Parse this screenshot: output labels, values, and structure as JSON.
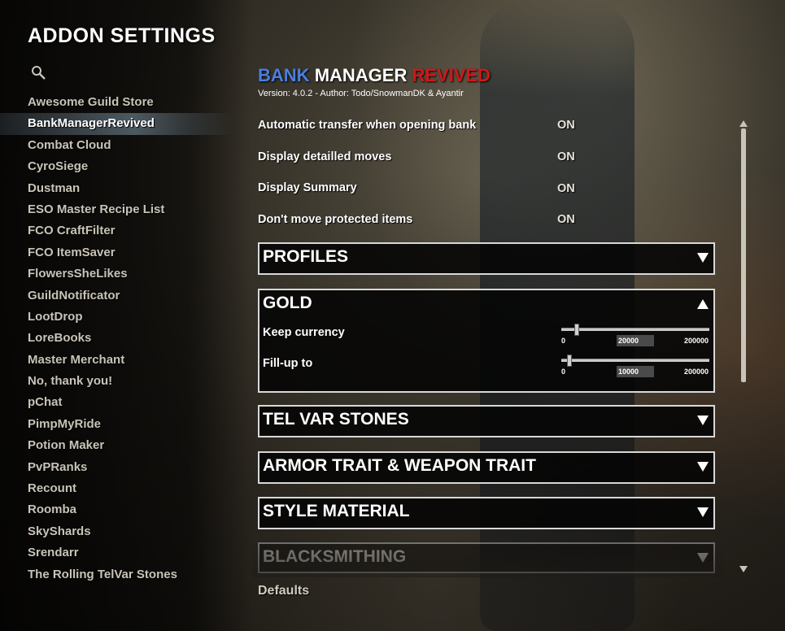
{
  "window": {
    "title": "ADDON SETTINGS"
  },
  "addons": [
    "Awesome Guild Store",
    "BankManagerRevived",
    "Combat Cloud",
    "CyroSiege",
    "Dustman",
    "ESO Master Recipe List",
    "FCO CraftFilter",
    "FCO ItemSaver",
    "FlowersSheLikes",
    "GuildNotificator",
    "LootDrop",
    "LoreBooks",
    "Master Merchant",
    "No, thank you!",
    "pChat",
    "PimpMyRide",
    "Potion Maker",
    "PvPRanks",
    "Recount",
    "Roomba",
    "SkyShards",
    "Srendarr",
    "The Rolling TelVar Stones"
  ],
  "selected_addon": "BankManagerRevived",
  "panel": {
    "title_parts": [
      "BANK",
      "MANAGER",
      "REVIVED"
    ],
    "version": "Version: 4.0.2  -  Author: Todo/SnowmanDK & Ayantir",
    "settings": [
      {
        "label": "Automatic transfer when opening bank",
        "value": "ON"
      },
      {
        "label": "Display  detailled moves",
        "value": "ON"
      },
      {
        "label": "Display Summary",
        "value": "ON"
      },
      {
        "label": "Don't move protected items",
        "value": "ON"
      }
    ],
    "sections": {
      "profiles": "PROFILES",
      "gold": "GOLD",
      "telvar": "TEL VAR STONES",
      "armor": "ARMOR TRAIT & WEAPON TRAIT",
      "style": "STYLE MATERIAL",
      "blacksmithing": "BLACKSMITHING"
    },
    "gold_sliders": [
      {
        "label": "Keep currency",
        "min": "0",
        "max": "200000",
        "value": "20000",
        "fraction": 0.1
      },
      {
        "label": "Fill-up to",
        "min": "0",
        "max": "200000",
        "value": "10000",
        "fraction": 0.05
      }
    ],
    "defaults_label": "Defaults"
  },
  "colors": {
    "bank": "#4a7fe0",
    "manager": "#ffffff",
    "revived": "#d01818"
  }
}
